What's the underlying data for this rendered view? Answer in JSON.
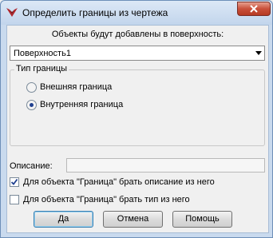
{
  "window": {
    "title": "Определить границы из чертежа",
    "icons": {
      "app": "red-bird-app-icon",
      "close": "close-x-icon"
    }
  },
  "objects": {
    "caption": "Объекты будут добавлены в поверхность:",
    "surface_selected": "Поверхность1"
  },
  "boundary_type": {
    "legend": "Тип границы",
    "options": [
      {
        "label": "Внешняя граница",
        "checked": false
      },
      {
        "label": "Внутренняя граница",
        "checked": true
      }
    ]
  },
  "description": {
    "label": "Описание:",
    "value": ""
  },
  "checkboxes": [
    {
      "label": "Для объекта \"Граница\" брать описание из него",
      "checked": true
    },
    {
      "label": "Для объекта \"Граница\" брать тип из него",
      "checked": false
    }
  ],
  "buttons": {
    "ok": "Да",
    "cancel": "Отмена",
    "help": "Помощь"
  },
  "colors": {
    "accent": "#3c7fb1",
    "close_button": "#c9503a",
    "frame": "#c9daee"
  }
}
